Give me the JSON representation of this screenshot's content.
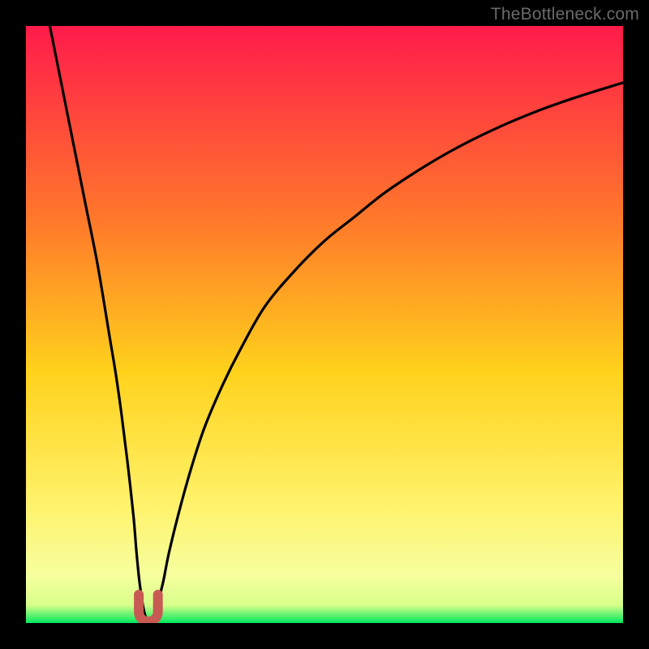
{
  "watermark": "TheBottleneck.com",
  "colors": {
    "top": "#ff1b4b",
    "mid_upper": "#ff7a2a",
    "mid": "#ffd21c",
    "mid_lower": "#fff26a",
    "lower": "#f6ff9e",
    "green": "#00e85d",
    "curve": "#000000",
    "marker": "#c85a54",
    "background": "#000000"
  },
  "chart_data": {
    "type": "line",
    "title": "",
    "xlabel": "",
    "ylabel": "",
    "xlim": [
      0,
      100
    ],
    "ylim": [
      0,
      100
    ],
    "series": [
      {
        "name": "bottleneck-curve",
        "x": [
          4,
          6,
          8,
          10,
          12,
          14,
          15,
          16,
          17,
          18,
          18.5,
          19,
          19.5,
          20,
          20.7,
          21.5,
          22,
          23,
          24,
          26,
          28,
          30,
          33,
          36,
          40,
          45,
          50,
          55,
          60,
          66,
          72,
          78,
          85,
          92,
          100
        ],
        "y": [
          100,
          90,
          80,
          70,
          60,
          48,
          42,
          35,
          27,
          18,
          12,
          7,
          3.5,
          1.2,
          0.5,
          1.2,
          3,
          7,
          12,
          20,
          27,
          33,
          40,
          46,
          53,
          59,
          64,
          68,
          72,
          76,
          79.5,
          82.5,
          85.5,
          88,
          90.5
        ]
      }
    ],
    "marker": {
      "name": "u-marker",
      "x_center": 20.5,
      "y_center": 2.5,
      "width": 3.2,
      "height": 4.5
    }
  }
}
